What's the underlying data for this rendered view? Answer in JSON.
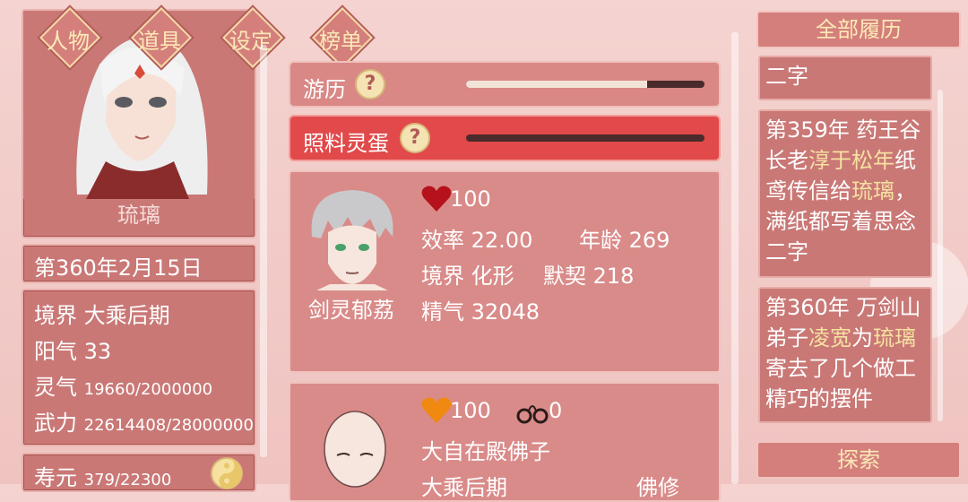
{
  "nav": {
    "tabs": [
      "人物",
      "道具",
      "设定",
      "榜单"
    ]
  },
  "character": {
    "name": "琉璃"
  },
  "date": "第360年2月15日",
  "stats": {
    "realm_label": "境界",
    "realm_value": "大乘后期",
    "yang_label": "阳气",
    "yang_value": "33",
    "spirit_label": "灵气",
    "spirit_value": "19660/2000000",
    "force_label": "武力",
    "force_value": "22614408/28000000",
    "life_label": "寿元",
    "life_value": "379/22300"
  },
  "tasks": [
    {
      "label": "游历",
      "progress": 0.76
    },
    {
      "label": "照料灵蛋",
      "progress": 0.0
    }
  ],
  "companions": [
    {
      "name": "剑灵郁荔",
      "heart": "100",
      "efficiency_label": "效率",
      "efficiency": "22.00",
      "age_label": "年龄",
      "age": "269",
      "realm_label": "境界",
      "realm": "化形",
      "bond_label": "默契",
      "bond": "218",
      "essence_label": "精气",
      "essence": "32048"
    },
    {
      "heart": "100",
      "cuffs": "0",
      "title": "大自在殿佛子",
      "realm": "大乘后期",
      "path": "佛修"
    }
  ],
  "history": {
    "header": "全部履历",
    "top_fragment": "二字",
    "entry1": {
      "line1": "第359年 药王谷",
      "line2_a": "长老",
      "line2_hl": "淳于松年",
      "line2_b": "纸",
      "line3_a": "鸢传信给",
      "line3_hl": "琉璃",
      "line3_b": "，",
      "line4": "满纸都写着思念",
      "line5": "二字"
    },
    "entry2": {
      "line1": "第360年 万剑山",
      "line2_a": "弟子",
      "line2_hl": "凌宽",
      "line2_b": "为",
      "line2_hl2": "琉璃",
      "line3": "寄去了几个做工",
      "line4": "精巧的摆件"
    },
    "explore": "探索"
  },
  "colors": {
    "panel": "#c97876",
    "accent_gold": "#fbe9b6",
    "active_task": "#e1494b",
    "heart_red": "#b5121b",
    "heart_orange": "#f0890f"
  }
}
